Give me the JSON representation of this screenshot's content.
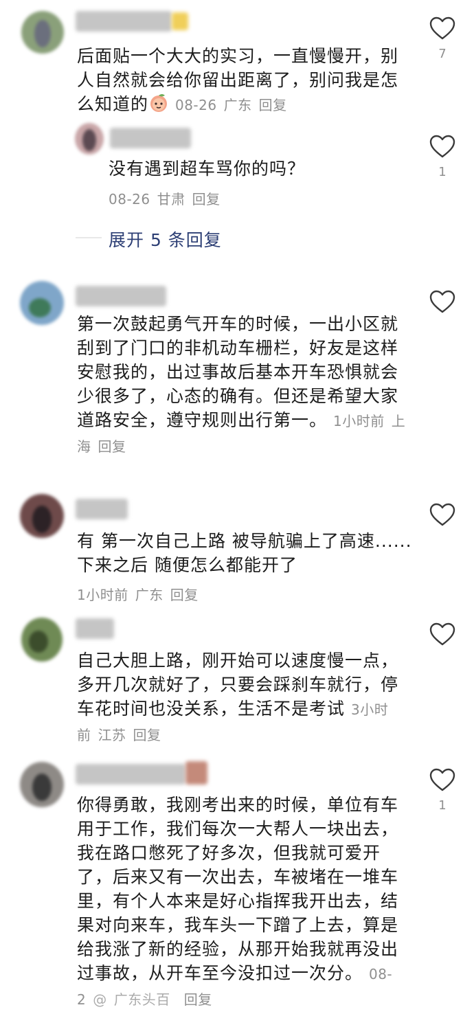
{
  "comments": [
    {
      "text": "后面贴一个大大的实习，一直慢慢开，别人自然就会给你留出距离了，别问我是怎么知道的",
      "time": "08-26",
      "location": "广东",
      "reply_label": "回复",
      "like_count": "7",
      "colors": {
        "avatar": "#8aa07a",
        "avatar_inner": "#6b6f7d",
        "name": "#c5c5c5",
        "name_tag": "#f0cf5a"
      }
    },
    {
      "text": "没有遇到超车骂你的吗？",
      "time": "08-26",
      "location": "甘肃",
      "reply_label": "回复",
      "like_count": "1",
      "expand_label": "展开 5 条回复",
      "colors": {
        "avatar": "#c9a6a8",
        "avatar_inner": "#5c4a52"
      }
    },
    {
      "text": "第一次鼓起勇气开车的时候，一出小区就刮到了门口的非机动车栅栏，好友是这样安慰我的，出过事故后基本开车恐惧就会少很多了，心态的确有。但还是希望大家道路安全，遵守规则出行第一。",
      "time": "1小时前",
      "location": "上海",
      "reply_label": "回复",
      "colors": {
        "avatar": "#7fa6c9",
        "avatar_inner": "#3f7a5a"
      }
    },
    {
      "text_line1": "有 第一次自己上路 被导航骗上了高速......",
      "text_line2": "下来之后 随便怎么都能开了",
      "time": "1小时前",
      "location": "广东",
      "reply_label": "回复",
      "colors": {
        "avatar": "#6e4a4a",
        "avatar_inner": "#2c2226"
      }
    },
    {
      "text": "自己大胆上路，刚开始可以速度慢一点，多开几次就好了，只要会踩刹车就行，停车花时间也没关系，生活不是考试",
      "time": "3小时前",
      "location": "江苏",
      "reply_label": "回复",
      "colors": {
        "avatar": "#6f8a55",
        "avatar_inner": "#3c4d2c"
      }
    },
    {
      "text": "你得勇敢，我刚考出来的时候，单位有车用于工作，我们每次一大帮人一块出去，我在路口憋死了好多次，但我就可爱开了，后来又有一次出去，车被堵在一堆车里，有个人本来是好心指挥我开出去，结果对向来车，我车头一下蹭了上去，算是给我涨了新的经验，从那开始我就再没出过事故，从开车至今没扣过一次分。",
      "time": "08-2",
      "reply_label": "回复",
      "like_count": "1",
      "colors": {
        "avatar": "#8e8a86",
        "avatar_inner": "#3a3a3a",
        "name_tag": "#c48a7a"
      }
    }
  ],
  "watermark": {
    "handle": "@",
    "text": "广东头百"
  },
  "colors": {
    "text": "#1c1c1c",
    "meta": "#8f8f8f",
    "expand": "#2c3e74",
    "heart_stroke": "#3a3a3a"
  }
}
